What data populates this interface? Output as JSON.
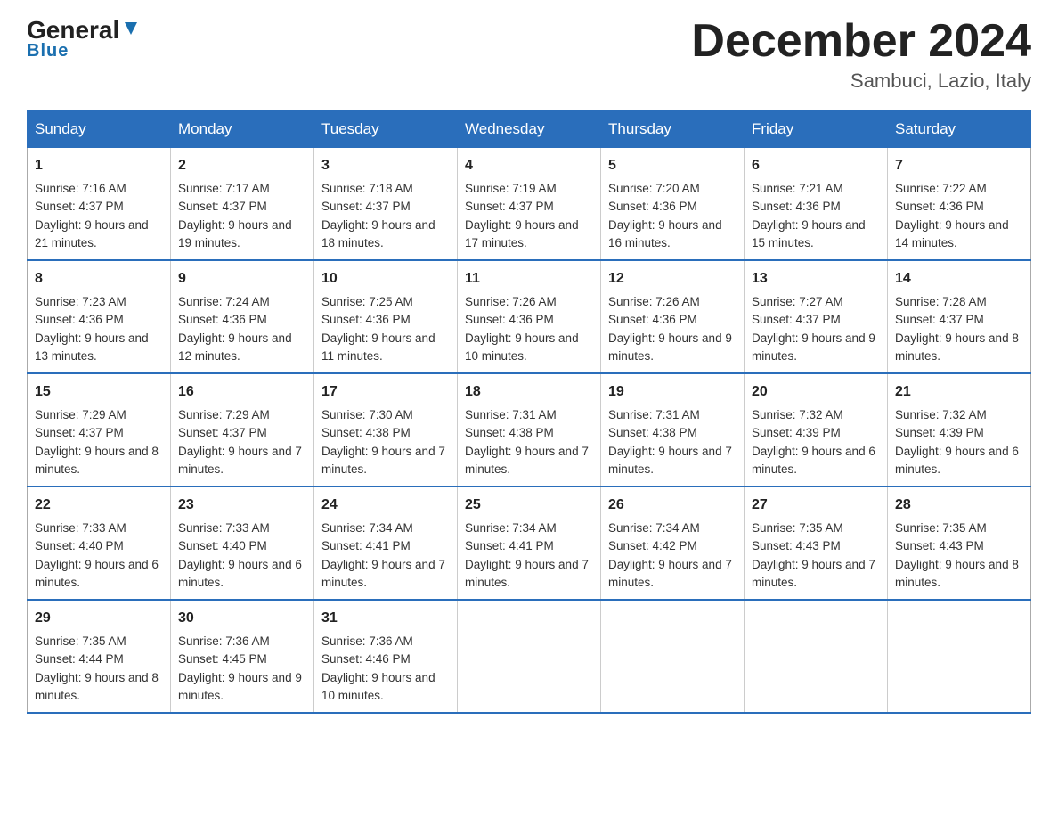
{
  "header": {
    "logo_general": "General",
    "logo_blue": "Blue",
    "month_title": "December 2024",
    "subtitle": "Sambuci, Lazio, Italy"
  },
  "days_of_week": [
    "Sunday",
    "Monday",
    "Tuesday",
    "Wednesday",
    "Thursday",
    "Friday",
    "Saturday"
  ],
  "weeks": [
    [
      {
        "day": "1",
        "sunrise": "7:16 AM",
        "sunset": "4:37 PM",
        "daylight": "9 hours and 21 minutes."
      },
      {
        "day": "2",
        "sunrise": "7:17 AM",
        "sunset": "4:37 PM",
        "daylight": "9 hours and 19 minutes."
      },
      {
        "day": "3",
        "sunrise": "7:18 AM",
        "sunset": "4:37 PM",
        "daylight": "9 hours and 18 minutes."
      },
      {
        "day": "4",
        "sunrise": "7:19 AM",
        "sunset": "4:37 PM",
        "daylight": "9 hours and 17 minutes."
      },
      {
        "day": "5",
        "sunrise": "7:20 AM",
        "sunset": "4:36 PM",
        "daylight": "9 hours and 16 minutes."
      },
      {
        "day": "6",
        "sunrise": "7:21 AM",
        "sunset": "4:36 PM",
        "daylight": "9 hours and 15 minutes."
      },
      {
        "day": "7",
        "sunrise": "7:22 AM",
        "sunset": "4:36 PM",
        "daylight": "9 hours and 14 minutes."
      }
    ],
    [
      {
        "day": "8",
        "sunrise": "7:23 AM",
        "sunset": "4:36 PM",
        "daylight": "9 hours and 13 minutes."
      },
      {
        "day": "9",
        "sunrise": "7:24 AM",
        "sunset": "4:36 PM",
        "daylight": "9 hours and 12 minutes."
      },
      {
        "day": "10",
        "sunrise": "7:25 AM",
        "sunset": "4:36 PM",
        "daylight": "9 hours and 11 minutes."
      },
      {
        "day": "11",
        "sunrise": "7:26 AM",
        "sunset": "4:36 PM",
        "daylight": "9 hours and 10 minutes."
      },
      {
        "day": "12",
        "sunrise": "7:26 AM",
        "sunset": "4:36 PM",
        "daylight": "9 hours and 9 minutes."
      },
      {
        "day": "13",
        "sunrise": "7:27 AM",
        "sunset": "4:37 PM",
        "daylight": "9 hours and 9 minutes."
      },
      {
        "day": "14",
        "sunrise": "7:28 AM",
        "sunset": "4:37 PM",
        "daylight": "9 hours and 8 minutes."
      }
    ],
    [
      {
        "day": "15",
        "sunrise": "7:29 AM",
        "sunset": "4:37 PM",
        "daylight": "9 hours and 8 minutes."
      },
      {
        "day": "16",
        "sunrise": "7:29 AM",
        "sunset": "4:37 PM",
        "daylight": "9 hours and 7 minutes."
      },
      {
        "day": "17",
        "sunrise": "7:30 AM",
        "sunset": "4:38 PM",
        "daylight": "9 hours and 7 minutes."
      },
      {
        "day": "18",
        "sunrise": "7:31 AM",
        "sunset": "4:38 PM",
        "daylight": "9 hours and 7 minutes."
      },
      {
        "day": "19",
        "sunrise": "7:31 AM",
        "sunset": "4:38 PM",
        "daylight": "9 hours and 7 minutes."
      },
      {
        "day": "20",
        "sunrise": "7:32 AM",
        "sunset": "4:39 PM",
        "daylight": "9 hours and 6 minutes."
      },
      {
        "day": "21",
        "sunrise": "7:32 AM",
        "sunset": "4:39 PM",
        "daylight": "9 hours and 6 minutes."
      }
    ],
    [
      {
        "day": "22",
        "sunrise": "7:33 AM",
        "sunset": "4:40 PM",
        "daylight": "9 hours and 6 minutes."
      },
      {
        "day": "23",
        "sunrise": "7:33 AM",
        "sunset": "4:40 PM",
        "daylight": "9 hours and 6 minutes."
      },
      {
        "day": "24",
        "sunrise": "7:34 AM",
        "sunset": "4:41 PM",
        "daylight": "9 hours and 7 minutes."
      },
      {
        "day": "25",
        "sunrise": "7:34 AM",
        "sunset": "4:41 PM",
        "daylight": "9 hours and 7 minutes."
      },
      {
        "day": "26",
        "sunrise": "7:34 AM",
        "sunset": "4:42 PM",
        "daylight": "9 hours and 7 minutes."
      },
      {
        "day": "27",
        "sunrise": "7:35 AM",
        "sunset": "4:43 PM",
        "daylight": "9 hours and 7 minutes."
      },
      {
        "day": "28",
        "sunrise": "7:35 AM",
        "sunset": "4:43 PM",
        "daylight": "9 hours and 8 minutes."
      }
    ],
    [
      {
        "day": "29",
        "sunrise": "7:35 AM",
        "sunset": "4:44 PM",
        "daylight": "9 hours and 8 minutes."
      },
      {
        "day": "30",
        "sunrise": "7:36 AM",
        "sunset": "4:45 PM",
        "daylight": "9 hours and 9 minutes."
      },
      {
        "day": "31",
        "sunrise": "7:36 AM",
        "sunset": "4:46 PM",
        "daylight": "9 hours and 10 minutes."
      },
      null,
      null,
      null,
      null
    ]
  ],
  "labels": {
    "sunrise": "Sunrise:",
    "sunset": "Sunset:",
    "daylight": "Daylight:"
  }
}
